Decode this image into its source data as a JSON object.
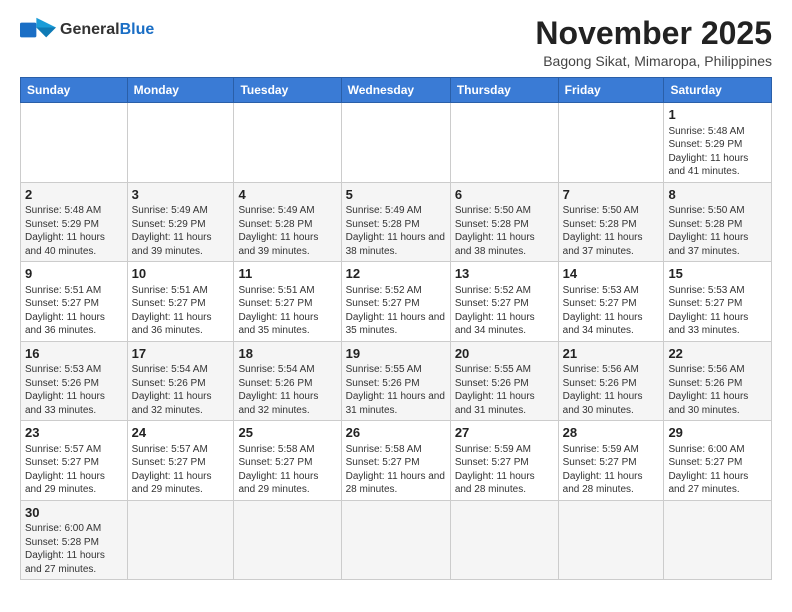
{
  "header": {
    "logo_general": "General",
    "logo_blue": "Blue",
    "month_title": "November 2025",
    "location": "Bagong Sikat, Mimaropa, Philippines"
  },
  "days_of_week": [
    "Sunday",
    "Monday",
    "Tuesday",
    "Wednesday",
    "Thursday",
    "Friday",
    "Saturday"
  ],
  "weeks": [
    [
      {
        "day": "",
        "sunrise": "",
        "sunset": "",
        "daylight": ""
      },
      {
        "day": "",
        "sunrise": "",
        "sunset": "",
        "daylight": ""
      },
      {
        "day": "",
        "sunrise": "",
        "sunset": "",
        "daylight": ""
      },
      {
        "day": "",
        "sunrise": "",
        "sunset": "",
        "daylight": ""
      },
      {
        "day": "",
        "sunrise": "",
        "sunset": "",
        "daylight": ""
      },
      {
        "day": "",
        "sunrise": "",
        "sunset": "",
        "daylight": ""
      },
      {
        "day": "1",
        "sunrise": "Sunrise: 5:48 AM",
        "sunset": "Sunset: 5:29 PM",
        "daylight": "Daylight: 11 hours and 41 minutes."
      }
    ],
    [
      {
        "day": "2",
        "sunrise": "Sunrise: 5:48 AM",
        "sunset": "Sunset: 5:29 PM",
        "daylight": "Daylight: 11 hours and 40 minutes."
      },
      {
        "day": "3",
        "sunrise": "Sunrise: 5:49 AM",
        "sunset": "Sunset: 5:29 PM",
        "daylight": "Daylight: 11 hours and 39 minutes."
      },
      {
        "day": "4",
        "sunrise": "Sunrise: 5:49 AM",
        "sunset": "Sunset: 5:28 PM",
        "daylight": "Daylight: 11 hours and 39 minutes."
      },
      {
        "day": "5",
        "sunrise": "Sunrise: 5:49 AM",
        "sunset": "Sunset: 5:28 PM",
        "daylight": "Daylight: 11 hours and 38 minutes."
      },
      {
        "day": "6",
        "sunrise": "Sunrise: 5:50 AM",
        "sunset": "Sunset: 5:28 PM",
        "daylight": "Daylight: 11 hours and 38 minutes."
      },
      {
        "day": "7",
        "sunrise": "Sunrise: 5:50 AM",
        "sunset": "Sunset: 5:28 PM",
        "daylight": "Daylight: 11 hours and 37 minutes."
      },
      {
        "day": "8",
        "sunrise": "Sunrise: 5:50 AM",
        "sunset": "Sunset: 5:28 PM",
        "daylight": "Daylight: 11 hours and 37 minutes."
      }
    ],
    [
      {
        "day": "9",
        "sunrise": "Sunrise: 5:51 AM",
        "sunset": "Sunset: 5:27 PM",
        "daylight": "Daylight: 11 hours and 36 minutes."
      },
      {
        "day": "10",
        "sunrise": "Sunrise: 5:51 AM",
        "sunset": "Sunset: 5:27 PM",
        "daylight": "Daylight: 11 hours and 36 minutes."
      },
      {
        "day": "11",
        "sunrise": "Sunrise: 5:51 AM",
        "sunset": "Sunset: 5:27 PM",
        "daylight": "Daylight: 11 hours and 35 minutes."
      },
      {
        "day": "12",
        "sunrise": "Sunrise: 5:52 AM",
        "sunset": "Sunset: 5:27 PM",
        "daylight": "Daylight: 11 hours and 35 minutes."
      },
      {
        "day": "13",
        "sunrise": "Sunrise: 5:52 AM",
        "sunset": "Sunset: 5:27 PM",
        "daylight": "Daylight: 11 hours and 34 minutes."
      },
      {
        "day": "14",
        "sunrise": "Sunrise: 5:53 AM",
        "sunset": "Sunset: 5:27 PM",
        "daylight": "Daylight: 11 hours and 34 minutes."
      },
      {
        "day": "15",
        "sunrise": "Sunrise: 5:53 AM",
        "sunset": "Sunset: 5:27 PM",
        "daylight": "Daylight: 11 hours and 33 minutes."
      }
    ],
    [
      {
        "day": "16",
        "sunrise": "Sunrise: 5:53 AM",
        "sunset": "Sunset: 5:26 PM",
        "daylight": "Daylight: 11 hours and 33 minutes."
      },
      {
        "day": "17",
        "sunrise": "Sunrise: 5:54 AM",
        "sunset": "Sunset: 5:26 PM",
        "daylight": "Daylight: 11 hours and 32 minutes."
      },
      {
        "day": "18",
        "sunrise": "Sunrise: 5:54 AM",
        "sunset": "Sunset: 5:26 PM",
        "daylight": "Daylight: 11 hours and 32 minutes."
      },
      {
        "day": "19",
        "sunrise": "Sunrise: 5:55 AM",
        "sunset": "Sunset: 5:26 PM",
        "daylight": "Daylight: 11 hours and 31 minutes."
      },
      {
        "day": "20",
        "sunrise": "Sunrise: 5:55 AM",
        "sunset": "Sunset: 5:26 PM",
        "daylight": "Daylight: 11 hours and 31 minutes."
      },
      {
        "day": "21",
        "sunrise": "Sunrise: 5:56 AM",
        "sunset": "Sunset: 5:26 PM",
        "daylight": "Daylight: 11 hours and 30 minutes."
      },
      {
        "day": "22",
        "sunrise": "Sunrise: 5:56 AM",
        "sunset": "Sunset: 5:26 PM",
        "daylight": "Daylight: 11 hours and 30 minutes."
      }
    ],
    [
      {
        "day": "23",
        "sunrise": "Sunrise: 5:57 AM",
        "sunset": "Sunset: 5:27 PM",
        "daylight": "Daylight: 11 hours and 29 minutes."
      },
      {
        "day": "24",
        "sunrise": "Sunrise: 5:57 AM",
        "sunset": "Sunset: 5:27 PM",
        "daylight": "Daylight: 11 hours and 29 minutes."
      },
      {
        "day": "25",
        "sunrise": "Sunrise: 5:58 AM",
        "sunset": "Sunset: 5:27 PM",
        "daylight": "Daylight: 11 hours and 29 minutes."
      },
      {
        "day": "26",
        "sunrise": "Sunrise: 5:58 AM",
        "sunset": "Sunset: 5:27 PM",
        "daylight": "Daylight: 11 hours and 28 minutes."
      },
      {
        "day": "27",
        "sunrise": "Sunrise: 5:59 AM",
        "sunset": "Sunset: 5:27 PM",
        "daylight": "Daylight: 11 hours and 28 minutes."
      },
      {
        "day": "28",
        "sunrise": "Sunrise: 5:59 AM",
        "sunset": "Sunset: 5:27 PM",
        "daylight": "Daylight: 11 hours and 28 minutes."
      },
      {
        "day": "29",
        "sunrise": "Sunrise: 6:00 AM",
        "sunset": "Sunset: 5:27 PM",
        "daylight": "Daylight: 11 hours and 27 minutes."
      }
    ],
    [
      {
        "day": "30",
        "sunrise": "Sunrise: 6:00 AM",
        "sunset": "Sunset: 5:28 PM",
        "daylight": "Daylight: 11 hours and 27 minutes."
      },
      {
        "day": "",
        "sunrise": "",
        "sunset": "",
        "daylight": ""
      },
      {
        "day": "",
        "sunrise": "",
        "sunset": "",
        "daylight": ""
      },
      {
        "day": "",
        "sunrise": "",
        "sunset": "",
        "daylight": ""
      },
      {
        "day": "",
        "sunrise": "",
        "sunset": "",
        "daylight": ""
      },
      {
        "day": "",
        "sunrise": "",
        "sunset": "",
        "daylight": ""
      },
      {
        "day": "",
        "sunrise": "",
        "sunset": "",
        "daylight": ""
      }
    ]
  ]
}
